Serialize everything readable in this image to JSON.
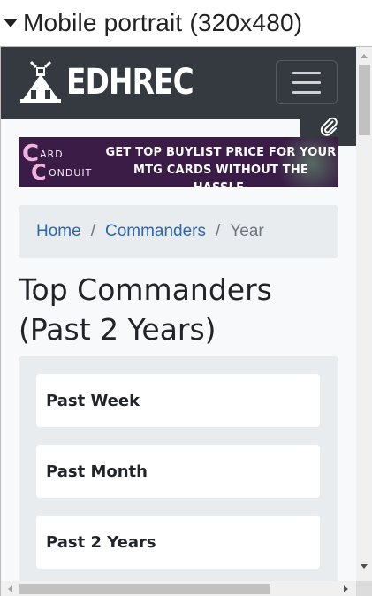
{
  "viewport_label": "Mobile portrait (320x480)",
  "header": {
    "brand": "EDHREC",
    "menu_label": "Toggle navigation",
    "bg_color": "#343a40"
  },
  "banner": {
    "logo_line1": "ARD",
    "logo_line2": "ONDUIT",
    "line1": "GET TOP BUYLIST PRICE FOR YOUR",
    "line2": "MTG CARDS WITHOUT THE HASSLE."
  },
  "breadcrumb": {
    "items": [
      {
        "label": "Home",
        "link": true
      },
      {
        "label": "Commanders",
        "link": true
      },
      {
        "label": "Year",
        "link": false
      }
    ],
    "separator": "/",
    "link_color": "#2a67b0"
  },
  "page_title": "Top Commanders (Past 2 Years)",
  "periods": [
    {
      "label": "Past Week"
    },
    {
      "label": "Past Month"
    },
    {
      "label": "Past 2 Years"
    }
  ],
  "icons": {
    "disclosure": "triangle-down-icon",
    "logo": "edhrec-logo-icon",
    "menu": "hamburger-icon",
    "attach": "paperclip-icon"
  }
}
